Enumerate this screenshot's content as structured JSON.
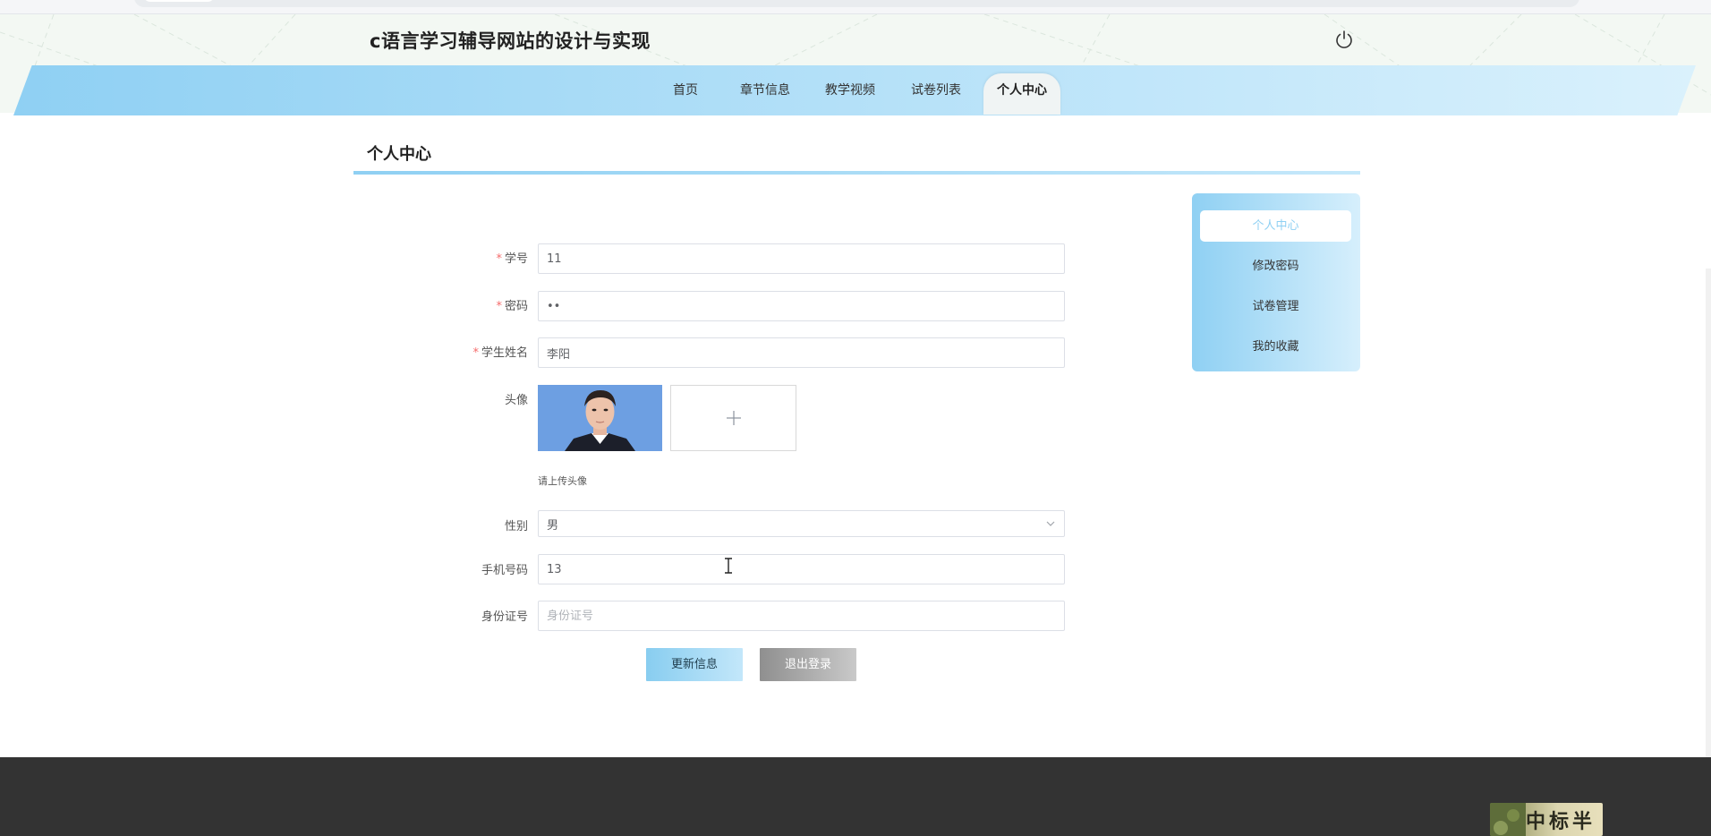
{
  "site": {
    "title": "c语言学习辅导网站的设计与实现"
  },
  "nav": {
    "items": [
      {
        "label": "首页"
      },
      {
        "label": "章节信息"
      },
      {
        "label": "教学视频"
      },
      {
        "label": "试卷列表"
      },
      {
        "label": "个人中心",
        "active": true
      }
    ]
  },
  "page": {
    "title": "个人中心"
  },
  "form": {
    "student_no": {
      "label": "学号",
      "value": "11",
      "required": true
    },
    "password": {
      "label": "密码",
      "value": "••",
      "required": true
    },
    "student_name": {
      "label": "学生姓名",
      "value": "李阳",
      "required": true
    },
    "avatar": {
      "label": "头像",
      "upload_hint": "请上传头像"
    },
    "gender": {
      "label": "性别",
      "value": "男"
    },
    "phone": {
      "label": "手机号码",
      "value": "13"
    },
    "id_card": {
      "label": "身份证号",
      "value": "",
      "placeholder": "身份证号"
    },
    "update_button": "更新信息",
    "logout_button": "退出登录"
  },
  "side_menu": {
    "items": [
      {
        "label": "个人中心",
        "active": true
      },
      {
        "label": "修改密码"
      },
      {
        "label": "试卷管理"
      },
      {
        "label": "我的收藏"
      }
    ]
  },
  "footer": {
    "stamp_text": "中标半"
  },
  "colors": {
    "accent": "#8fd0f3",
    "accent_light": "#c3e7fa",
    "required": "#f56c6c",
    "footer": "#333333",
    "logout": "#9a9a9a"
  },
  "icons": {
    "power": "power-icon",
    "upload": "plus-icon",
    "select": "chevron-down-icon",
    "cursor": "text-cursor-icon"
  }
}
